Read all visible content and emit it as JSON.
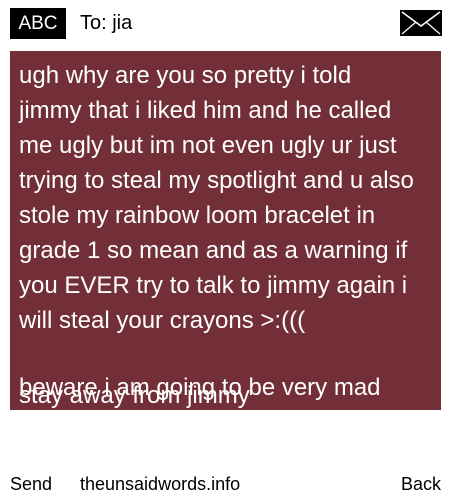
{
  "header": {
    "mode_label": "ABC",
    "to_label": "To: jia",
    "envelope_icon": "envelope-icon"
  },
  "message": {
    "body": "ugh why are you so pretty i told jimmy that i liked him and he called me ugly but im not even ugly ur just trying to steal my spotlight and u also stole my rainbow loom bracelet in grade 1 so mean and as a warning if you EVER try to talk to jimmy again i will steal your crayons >:(((",
    "overlap_line_1": "beware i am going to be very mad",
    "overlap_line_2": "stay away from jimmy",
    "background_color": "#722f37",
    "text_color": "#ffffff"
  },
  "footer": {
    "send_label": "Send",
    "site_label": "theunsaidwords.info",
    "back_label": "Back"
  }
}
